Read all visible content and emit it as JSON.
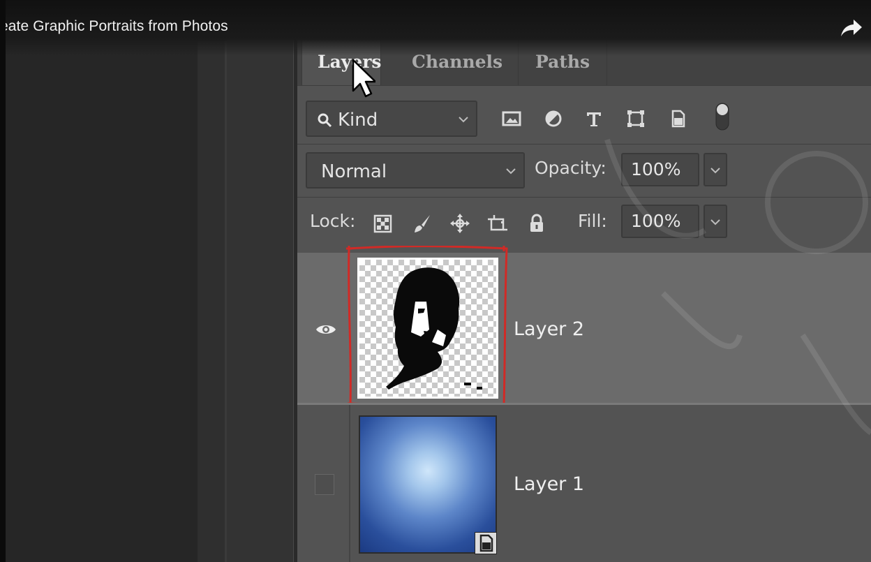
{
  "video": {
    "title": "eate Graphic Portraits from Photos",
    "share_icon": "share-arrow-icon"
  },
  "panel": {
    "tabs": [
      {
        "label": "Layers",
        "active": true
      },
      {
        "label": "Channels",
        "active": false
      },
      {
        "label": "Paths",
        "active": false
      }
    ],
    "filter": {
      "kind_label": "Kind",
      "icons": [
        "pixel-layer-filter-icon",
        "adjustment-layer-filter-icon",
        "type-layer-filter-icon",
        "shape-layer-filter-icon",
        "smart-object-filter-icon",
        "filter-toggle-icon"
      ]
    },
    "blend": {
      "mode": "Normal",
      "opacity_label": "Opacity:",
      "opacity_value": "100%"
    },
    "lock": {
      "label": "Lock:",
      "icons": [
        "lock-transparent-pixels-icon",
        "lock-image-pixels-icon",
        "lock-position-icon",
        "lock-artboard-icon",
        "lock-all-icon"
      ],
      "fill_label": "Fill:",
      "fill_value": "100%"
    },
    "layers": [
      {
        "name": "Layer 2",
        "visible": true,
        "selected": true
      },
      {
        "name": "Layer 1",
        "visible": false,
        "selected": false,
        "smart_object": true
      }
    ]
  },
  "colors": {
    "panel_bg": "#535353",
    "selected_row": "#6b6b6b",
    "highlight_outline": "#d12a26"
  }
}
